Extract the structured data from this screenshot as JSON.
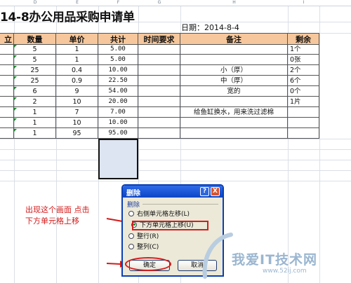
{
  "sheet": {
    "column_letters": [
      "D",
      "E",
      "F",
      "G",
      "H",
      "I"
    ],
    "title": "14-8办公用品采购申请单",
    "date_label": "日期：2014-8-4",
    "headers": [
      "立",
      "数量",
      "单价",
      "共计",
      "时间要求",
      "备注",
      "剩余"
    ],
    "rows": [
      {
        "qty": "5",
        "price": "1",
        "total": "5.00",
        "time": "",
        "note": "",
        "remain": "1个"
      },
      {
        "qty": "5",
        "price": "1",
        "total": "5.00",
        "time": "",
        "note": "",
        "remain": "0张"
      },
      {
        "qty": "25",
        "price": "0.4",
        "total": "10.00",
        "time": "",
        "note": "小（厚）",
        "remain": "2个"
      },
      {
        "qty": "25",
        "price": "0.9",
        "total": "22.50",
        "time": "",
        "note": "中（厚）",
        "remain": "6个"
      },
      {
        "qty": "6",
        "price": "9",
        "total": "54.00",
        "time": "",
        "note": "宽的",
        "remain": "0个"
      },
      {
        "qty": "2",
        "price": "10",
        "total": "20.00",
        "time": "",
        "note": "",
        "remain": "1片"
      },
      {
        "qty": "1",
        "price": "7",
        "total": "7.00",
        "time": "",
        "note": "给鱼缸换水，用来洗过滤棉",
        "remain": ""
      },
      {
        "qty": "1",
        "price": "10",
        "total": "10.00",
        "time": "",
        "note": "",
        "remain": ""
      },
      {
        "qty": "1",
        "price": "95",
        "total": "95.00",
        "time": "",
        "note": "",
        "remain": ""
      }
    ]
  },
  "dialog": {
    "title": "删除",
    "help_glyph": "?",
    "close_glyph": "X",
    "group_label": "删除",
    "options": [
      {
        "label": "右侧单元格左移(L)",
        "selected": false
      },
      {
        "label": "下方单元格上移(U)",
        "selected": true
      },
      {
        "label": "整行(R)",
        "selected": false
      },
      {
        "label": "整列(C)",
        "selected": false
      }
    ],
    "ok_label": "确定",
    "cancel_label": "取消"
  },
  "annotation": {
    "line1": "出现这个画面 点击",
    "line2": "下方单元格上移",
    "color": "#d31b1b"
  },
  "watermark": {
    "main": "我爱IT技术网",
    "sub": "www.52ij.com"
  },
  "colors": {
    "header_fill": "#f6c79c",
    "selection_fill": "#dde4f2",
    "dialog_title": "#0b45c6",
    "highlight": "#d21e1e"
  }
}
